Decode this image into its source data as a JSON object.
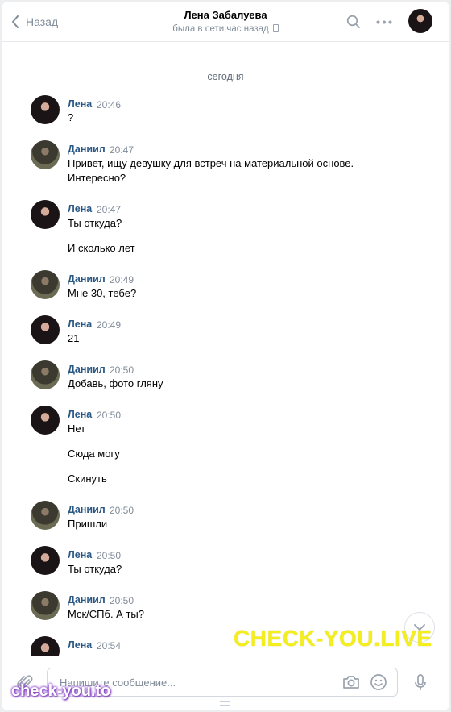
{
  "header": {
    "back_label": "Назад",
    "contact_name": "Лена Забалуева",
    "status": "была в сети час назад"
  },
  "date_divider": "сегодня",
  "messages": [
    {
      "author": "Лена",
      "time": "20:46",
      "lines": [
        "?"
      ]
    },
    {
      "author": "Даниил",
      "time": "20:47",
      "lines": [
        "Привет, ищу девушку для встреч на материальной основе.",
        "Интересно?"
      ]
    },
    {
      "author": "Лена",
      "time": "20:47",
      "lines": [
        "Ты откуда?",
        "И сколько лет"
      ]
    },
    {
      "author": "Даниил",
      "time": "20:49",
      "lines": [
        "Мне 30, тебе?"
      ]
    },
    {
      "author": "Лена",
      "time": "20:49",
      "lines": [
        "21"
      ]
    },
    {
      "author": "Даниил",
      "time": "20:50",
      "lines": [
        "Добавь, фото гляну"
      ]
    },
    {
      "author": "Лена",
      "time": "20:50",
      "lines": [
        "Нет",
        "Сюда могу",
        "Скинуть"
      ]
    },
    {
      "author": "Даниил",
      "time": "20:50",
      "lines": [
        "Пришли"
      ]
    },
    {
      "author": "Лена",
      "time": "20:50",
      "lines": [
        "Ты откуда?"
      ]
    },
    {
      "author": "Даниил",
      "time": "20:50",
      "lines": [
        "Мск/СПб. А ты?"
      ]
    },
    {
      "author": "Лена",
      "time": "20:54",
      "lines": []
    }
  ],
  "composer": {
    "placeholder": "Напишите сообщение..."
  },
  "watermarks": {
    "large": "CHECK-YOU.LIVE",
    "small": "check-you.to"
  },
  "colors": {
    "author_name": "#2a5885",
    "secondary_text": "#818c99",
    "watermark_yellow": "#f5ee1f",
    "watermark_purple": "#8a3fd0"
  },
  "icons": [
    "chevron-left-icon",
    "search-icon",
    "more-icon",
    "phone-icon",
    "attach-icon",
    "camera-icon",
    "smile-icon",
    "mic-icon",
    "chevron-down-icon"
  ]
}
